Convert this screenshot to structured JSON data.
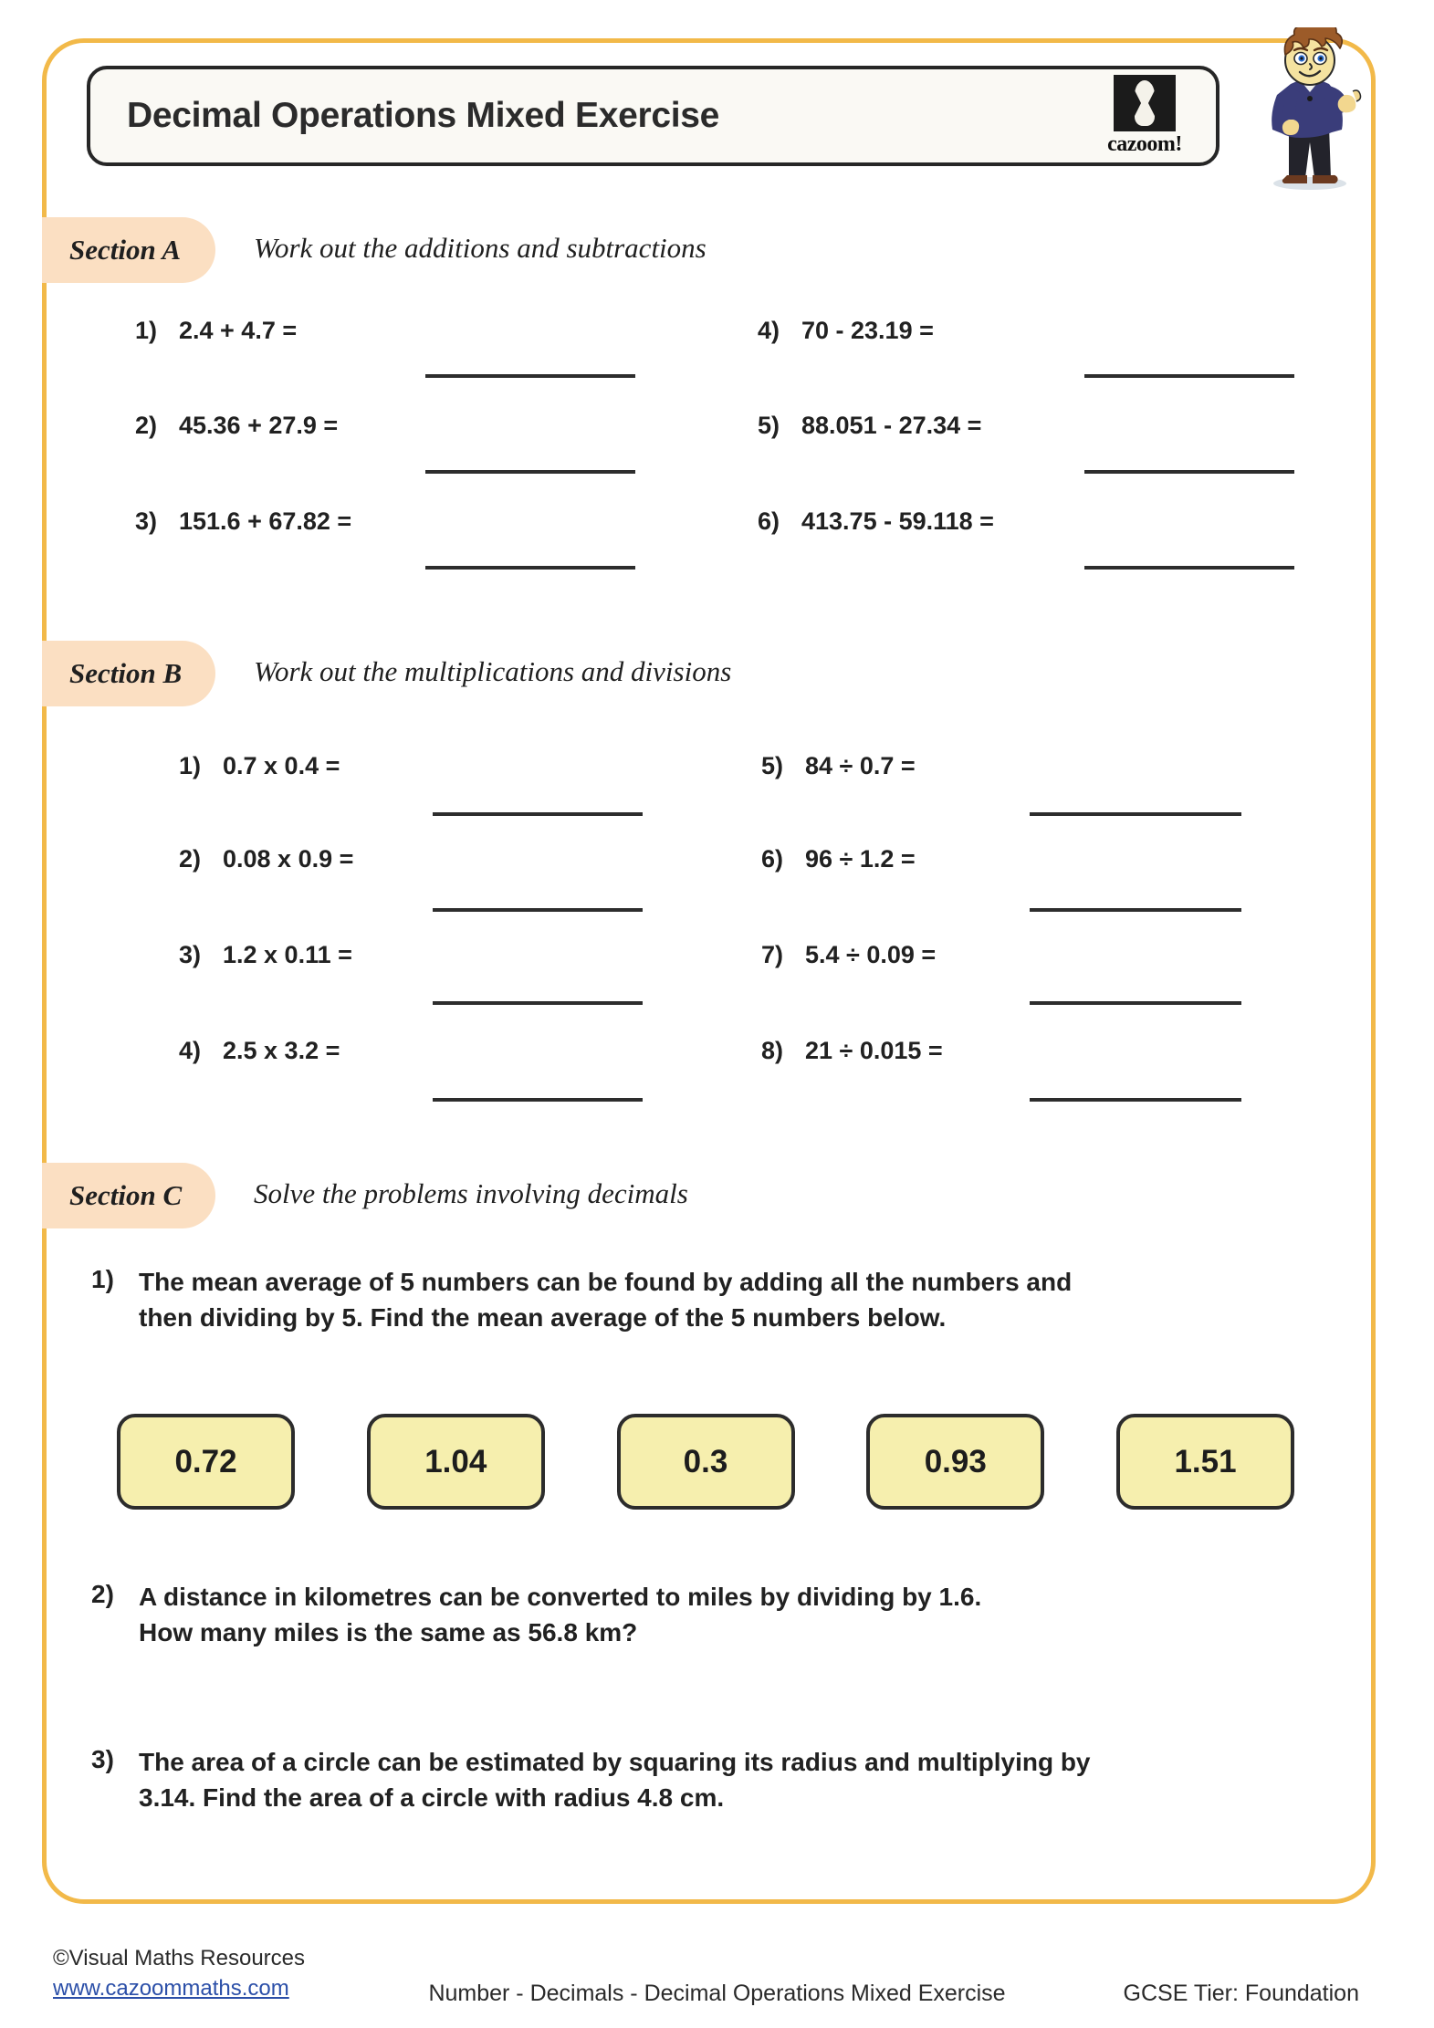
{
  "worksheet": {
    "title": "Decimal Operations Mixed Exercise",
    "logo_word": "cazoom!",
    "logo_icon": "cazoom-hourglass-logo"
  },
  "sections": [
    {
      "label": "Section A",
      "description": "Work out the additions and subtractions",
      "left_questions": [
        {
          "num": "1)",
          "text": "2.4 + 4.7 ="
        },
        {
          "num": "2)",
          "text": "45.36 + 27.9 ="
        },
        {
          "num": "3)",
          "text": "151.6 + 67.82 ="
        }
      ],
      "right_questions": [
        {
          "num": "4)",
          "text": "70 - 23.19 ="
        },
        {
          "num": "5)",
          "text": "88.051 - 27.34 ="
        },
        {
          "num": "6)",
          "text": "413.75 - 59.118 ="
        }
      ]
    },
    {
      "label": "Section B",
      "description": "Work out the multiplications and divisions",
      "left_questions": [
        {
          "num": "1)",
          "text": "0.7 x 0.4 ="
        },
        {
          "num": "2)",
          "text": "0.08 x 0.9 ="
        },
        {
          "num": "3)",
          "text": "1.2 x 0.11 ="
        },
        {
          "num": "4)",
          "text": "2.5 x 3.2 ="
        }
      ],
      "right_questions": [
        {
          "num": "5)",
          "text": "84 ÷ 0.7 ="
        },
        {
          "num": "6)",
          "text": "96 ÷ 1.2 ="
        },
        {
          "num": "7)",
          "text": "5.4 ÷ 0.09 ="
        },
        {
          "num": "8)",
          "text": "21 ÷ 0.015 ="
        }
      ]
    },
    {
      "label": "Section C",
      "description": "Solve the problems involving decimals",
      "problems": [
        {
          "num": "1)",
          "line1": "The mean average of  5 numbers can be found by adding all the numbers and",
          "line2": "then dividing by 5. Find the mean average of  the 5 numbers below."
        },
        {
          "num": "2)",
          "line1": "A distance in kilometres can be converted to miles by dividing by 1.6.",
          "line2": "How many miles is the same as 56.8 km?"
        },
        {
          "num": "3)",
          "line1": "The area of  a circle can be estimated by squaring its radius and multiplying by",
          "line2": "3.14. Find the area of  a circle with radius 4.8 cm."
        }
      ],
      "number_cards": [
        "0.72",
        "1.04",
        "0.3",
        "0.93",
        "1.51"
      ]
    }
  ],
  "footer": {
    "copyright": "©Visual Maths Resources",
    "url": "www.cazoommaths.com",
    "center": "Number - Decimals - Decimal Operations Mixed Exercise",
    "tier": "GCSE Tier: Foundation"
  },
  "colors": {
    "page_border": "#F2B949",
    "section_tag_bg": "#FBDFC2",
    "number_card_bg": "#F6EFAE",
    "title_box_bg": "#FAF9F4",
    "link": "#2B4FA8"
  }
}
